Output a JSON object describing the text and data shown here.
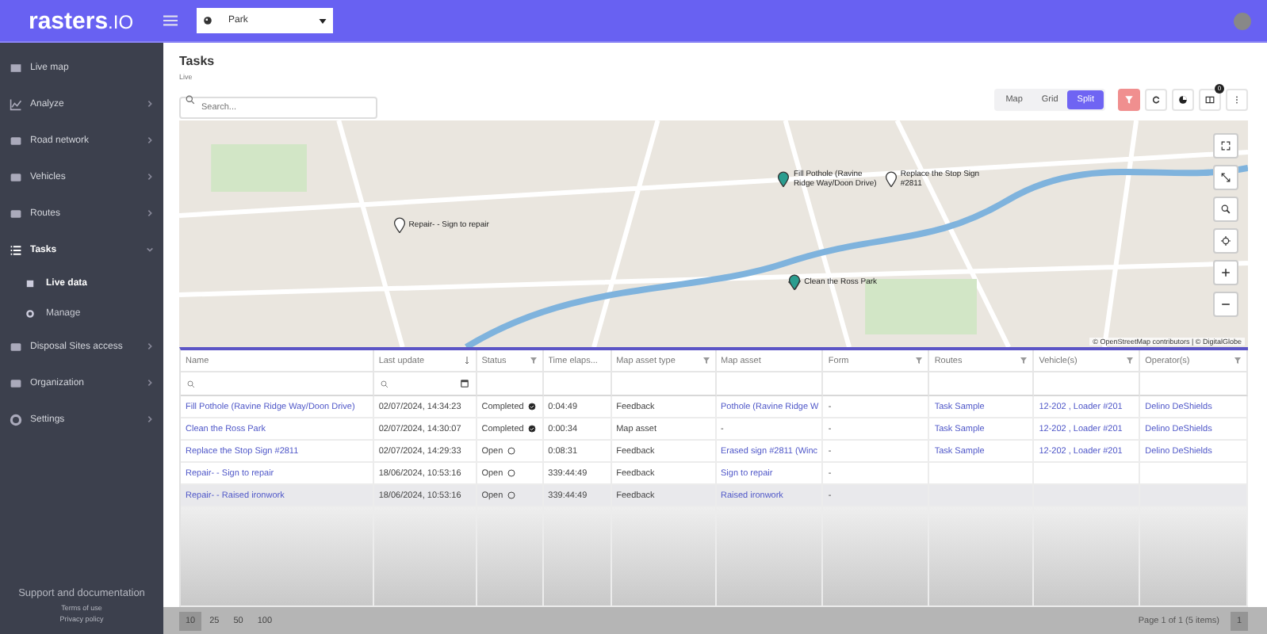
{
  "topbar": {
    "logo": "rasters",
    "logo_suffix": ".IO",
    "project": "Park"
  },
  "sidebar": {
    "items": [
      {
        "label": "Live map",
        "has_children": false,
        "expanded": false
      },
      {
        "label": "Analyze",
        "has_children": true,
        "expanded": false
      },
      {
        "label": "Road network",
        "has_children": true,
        "expanded": false
      },
      {
        "label": "Vehicles",
        "has_children": true,
        "expanded": false
      },
      {
        "label": "Routes",
        "has_children": true,
        "expanded": false
      },
      {
        "label": "Tasks",
        "has_children": true,
        "expanded": true,
        "children": [
          {
            "label": "Live data",
            "selected": true
          },
          {
            "label": "Manage",
            "selected": false
          }
        ]
      },
      {
        "label": "Disposal Sites access",
        "has_children": true,
        "expanded": false
      },
      {
        "label": "Organization",
        "has_children": true,
        "expanded": false
      },
      {
        "label": "Settings",
        "has_children": true,
        "expanded": false
      }
    ],
    "footer": {
      "support": "Support and documentation",
      "terms": "Terms of use",
      "privacy": "Privacy policy"
    }
  },
  "page": {
    "title": "Tasks",
    "subtitle": "Live"
  },
  "search": {
    "placeholder": "Search..."
  },
  "views": [
    {
      "label": "Map",
      "selected": false
    },
    {
      "label": "Grid",
      "selected": false
    },
    {
      "label": "Split",
      "selected": true
    }
  ],
  "toolbar": {
    "filter_active": true,
    "badge": "0"
  },
  "map": {
    "markers": [
      {
        "label": "Repair- - Sign to repair",
        "kind": "open"
      },
      {
        "label": "Fill Pothole (Ravine Ridge Way/Doon Drive)",
        "kind": "done"
      },
      {
        "label": "Replace the Stop Sign #2811",
        "kind": "open"
      },
      {
        "label": "Clean the Ross Park",
        "kind": "area"
      }
    ],
    "attribution": "© OpenStreetMap contributors | © DigitalGlobe"
  },
  "table": {
    "columns": [
      {
        "label": "Name",
        "filter": false,
        "sort": false,
        "search": true
      },
      {
        "label": "Last update",
        "filter": false,
        "sort": true,
        "search": true,
        "date": true
      },
      {
        "label": "Status",
        "filter": true,
        "sort": false,
        "search": false
      },
      {
        "label": "Time elaps...",
        "filter": false,
        "sort": false,
        "search": false
      },
      {
        "label": "Map asset type",
        "filter": true,
        "sort": false,
        "search": false
      },
      {
        "label": "Map asset",
        "filter": false,
        "sort": false,
        "search": false
      },
      {
        "label": "Form",
        "filter": true,
        "sort": false,
        "search": false
      },
      {
        "label": "Routes",
        "filter": true,
        "sort": false,
        "search": false
      },
      {
        "label": "Vehicle(s)",
        "filter": true,
        "sort": false,
        "search": false
      },
      {
        "label": "Operator(s)",
        "filter": true,
        "sort": false,
        "search": false
      }
    ],
    "rows": [
      {
        "name": "Fill Pothole (Ravine Ridge Way/Doon Drive)",
        "updated": "02/07/2024, 14:34:23",
        "status": "Completed",
        "completed": true,
        "elapsed": "0:04:49",
        "asset_type": "Feedback",
        "asset": "Pothole (Ravine Ridge W",
        "form": "-",
        "routes": "Task Sample",
        "vehicles": "12-202 , Loader #201",
        "operators": "Delino DeShields",
        "hovered": false
      },
      {
        "name": "Clean the Ross Park",
        "updated": "02/07/2024, 14:30:07",
        "status": "Completed",
        "completed": true,
        "elapsed": "0:00:34",
        "asset_type": "Map asset",
        "asset": "-",
        "form": "-",
        "routes": "Task Sample",
        "vehicles": "12-202 , Loader #201",
        "operators": "Delino DeShields",
        "hovered": false
      },
      {
        "name": "Replace the Stop Sign #2811",
        "updated": "02/07/2024, 14:29:33",
        "status": "Open",
        "completed": false,
        "elapsed": "0:08:31",
        "asset_type": "Feedback",
        "asset": "Erased sign #2811 (Winc",
        "form": "-",
        "routes": "Task Sample",
        "vehicles": "12-202 , Loader #201",
        "operators": "Delino DeShields",
        "hovered": false
      },
      {
        "name": "Repair- - Sign to repair",
        "updated": "18/06/2024, 10:53:16",
        "status": "Open",
        "completed": false,
        "elapsed": "339:44:49",
        "asset_type": "Feedback",
        "asset": "Sign to repair",
        "form": "-",
        "hovered": false
      },
      {
        "name": "Repair- - Raised ironwork",
        "updated": "18/06/2024, 10:53:16",
        "status": "Open",
        "completed": false,
        "elapsed": "339:44:49",
        "asset_type": "Feedback",
        "asset": "Raised ironwork",
        "form": "-",
        "hovered": true
      }
    ]
  },
  "pager": {
    "sizes": [
      {
        "label": "10",
        "selected": true
      },
      {
        "label": "25",
        "selected": false
      },
      {
        "label": "50",
        "selected": false
      },
      {
        "label": "100",
        "selected": false
      }
    ],
    "info": "Page 1 of 1 (5 items)",
    "pages": [
      {
        "label": "1",
        "selected": true
      }
    ]
  }
}
